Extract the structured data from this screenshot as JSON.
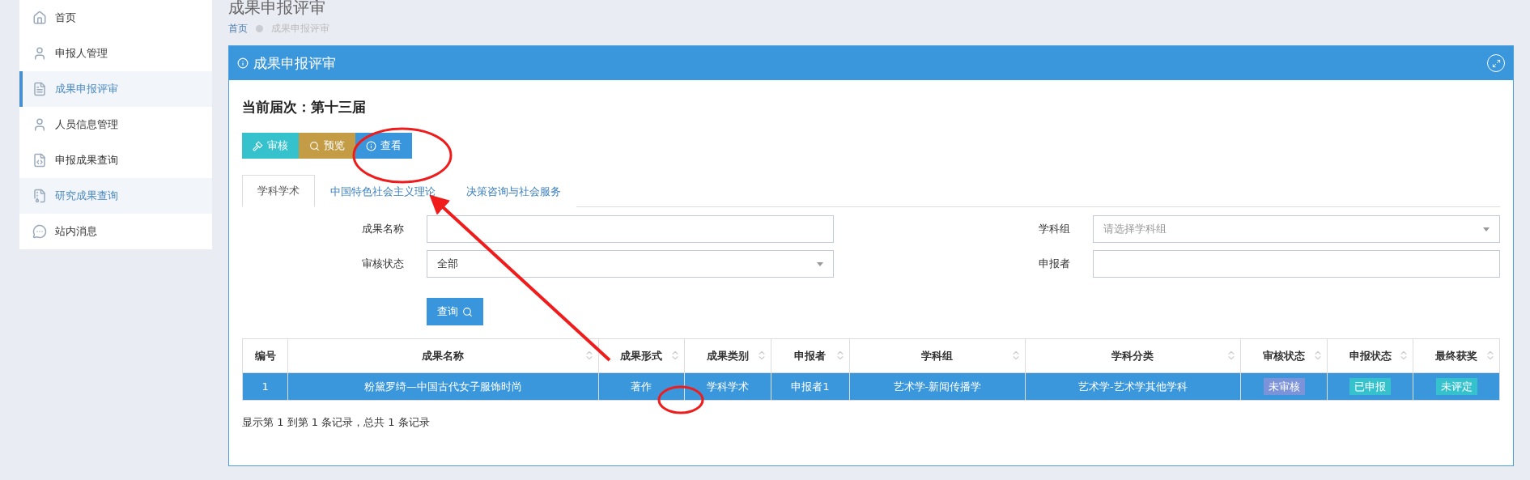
{
  "sidebar": {
    "items": [
      {
        "label": "首页",
        "kind": "home",
        "selected": false,
        "highlighted": false
      },
      {
        "label": "申报人管理",
        "kind": "user",
        "selected": false,
        "highlighted": false
      },
      {
        "label": "成果申报评审",
        "kind": "document",
        "selected": true,
        "highlighted": true
      },
      {
        "label": "人员信息管理",
        "kind": "user",
        "selected": false,
        "highlighted": false
      },
      {
        "label": "申报成果查询",
        "kind": "code",
        "selected": false,
        "highlighted": false
      },
      {
        "label": "研究成果查询",
        "kind": "archive",
        "selected": false,
        "highlighted": true
      },
      {
        "label": "站内消息",
        "kind": "message",
        "selected": false,
        "highlighted": false
      }
    ]
  },
  "page_title": "成果申报评审",
  "breadcrumb": [
    "首页",
    "成果申报评审"
  ],
  "panel": {
    "title": "成果申报评审",
    "current_session": "当前届次：第十三届",
    "actions": [
      {
        "label": "审核",
        "kind": "audit"
      },
      {
        "label": "预览",
        "kind": "preview"
      },
      {
        "label": "查看",
        "kind": "view"
      }
    ],
    "tabs": [
      {
        "label": "学科学术",
        "selected": true
      },
      {
        "label": "中国特色社会主义理论",
        "selected": false
      },
      {
        "label": "决策咨询与社会服务",
        "selected": false
      }
    ],
    "filters": [
      {
        "label": "成果名称",
        "kind": "text"
      },
      {
        "label": "学科组",
        "kind": "select",
        "placeholder": "请选择学科组"
      },
      {
        "label": "审核状态",
        "kind": "select",
        "value": "全部"
      },
      {
        "label": "申报者",
        "kind": "text"
      }
    ],
    "search_button": "查询",
    "table": {
      "columns": [
        {
          "label": "编号",
          "sortable": false
        },
        {
          "label": "成果名称",
          "sortable": true
        },
        {
          "label": "成果形式",
          "sortable": true
        },
        {
          "label": "成果类别",
          "sortable": true
        },
        {
          "label": "申报者",
          "sortable": true
        },
        {
          "label": "学科组",
          "sortable": true
        },
        {
          "label": "学科分类",
          "sortable": true
        },
        {
          "label": "审核状态",
          "sortable": true
        },
        {
          "label": "申报状态",
          "sortable": true
        },
        {
          "label": "最终获奖",
          "sortable": true
        }
      ],
      "rows": [
        {
          "selected": true,
          "cells": [
            {
              "text": "1"
            },
            {
              "text": "粉黛罗绮—中国古代女子服饰时尚"
            },
            {
              "text": "著作"
            },
            {
              "text": "学科学术"
            },
            {
              "text": "申报者1"
            },
            {
              "text": "艺术学-新闻传播学"
            },
            {
              "text": "艺术学-艺术学其他学科"
            },
            {
              "text": "未审核",
              "color": "#7d93d9"
            },
            {
              "text": "已申报",
              "color": "#36c2cc"
            },
            {
              "text": "未评定",
              "color": "#36c2cc"
            }
          ]
        }
      ]
    },
    "footer": "显示第 1 到第 1 条记录，总共 1 条记录"
  }
}
